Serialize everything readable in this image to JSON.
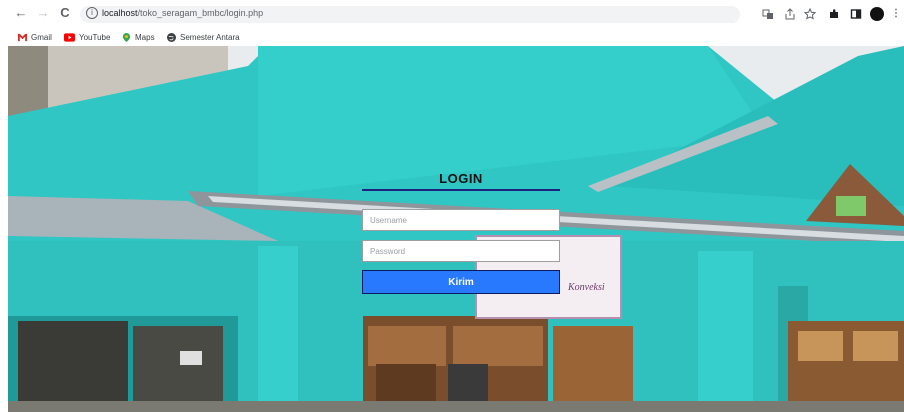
{
  "browser": {
    "url_host": "localhost",
    "url_path": "/toko_seragam_bmbc/login.php",
    "nav": {
      "back": "←",
      "forward": "→",
      "reload": "C"
    }
  },
  "bookmarks": [
    {
      "label": "Gmail",
      "icon": "gmail-icon",
      "color": "#d93025"
    },
    {
      "label": "YouTube",
      "icon": "youtube-icon",
      "color": "#ff0000"
    },
    {
      "label": "Maps",
      "icon": "maps-icon",
      "color": "#fbbc04"
    },
    {
      "label": "Semester Antara",
      "icon": "globe-icon",
      "color": "#3c4043"
    }
  ],
  "login": {
    "title": "LOGIN",
    "username_placeholder": "Username",
    "password_placeholder": "Password",
    "submit_label": "Kirim"
  },
  "background": {
    "sign_text": "Konveksi"
  },
  "colors": {
    "accent": "#2979ff",
    "rule": "#1a237e",
    "wall": "#2fc6c4"
  }
}
